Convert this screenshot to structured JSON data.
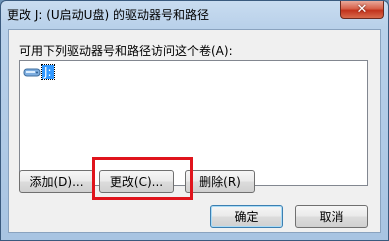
{
  "window": {
    "title": "更改 J: (U启动U盘) 的驱动器号和路径",
    "close_label": "✕"
  },
  "dialog": {
    "group_label": "可用下列驱动器号和路径访问这个卷(A):",
    "list_items": [
      "J:"
    ],
    "buttons": {
      "add": "添加(D)...",
      "change": "更改(C)...",
      "delete": "删除(R)",
      "ok": "确定",
      "cancel": "取消"
    }
  },
  "colors": {
    "highlight": "#e0141c",
    "selection": "#3399ff"
  },
  "icons": {
    "drive": "drive-icon",
    "close": "close-icon"
  }
}
